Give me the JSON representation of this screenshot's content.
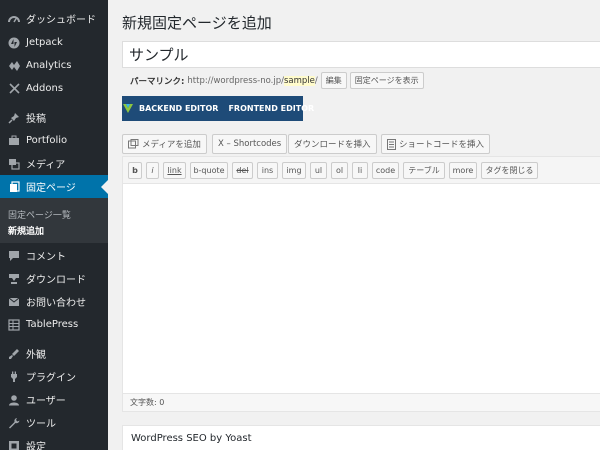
{
  "sidebar": {
    "items": [
      {
        "label": "ダッシュボード",
        "icon": "dashboard-icon"
      },
      {
        "label": "Jetpack",
        "icon": "jetpack-icon"
      },
      {
        "label": "Analytics",
        "icon": "analytics-icon"
      },
      {
        "label": "Addons",
        "icon": "addons-icon"
      },
      {
        "label": "投稿",
        "icon": "pin-icon"
      },
      {
        "label": "Portfolio",
        "icon": "portfolio-icon"
      },
      {
        "label": "メディア",
        "icon": "media-icon"
      },
      {
        "label": "固定ページ",
        "icon": "pages-icon"
      },
      {
        "label": "コメント",
        "icon": "comment-icon"
      },
      {
        "label": "ダウンロード",
        "icon": "download-icon"
      },
      {
        "label": "お問い合わせ",
        "icon": "mail-icon"
      },
      {
        "label": "TablePress",
        "icon": "table-icon"
      },
      {
        "label": "外観",
        "icon": "appearance-icon"
      },
      {
        "label": "プラグイン",
        "icon": "plugin-icon"
      },
      {
        "label": "ユーザー",
        "icon": "user-icon"
      },
      {
        "label": "ツール",
        "icon": "tools-icon"
      },
      {
        "label": "設定",
        "icon": "settings-icon"
      }
    ],
    "submenu": [
      "固定ページ一覧",
      "新規追加"
    ]
  },
  "main": {
    "title": "新規固定ページを追加",
    "post_title": "サンプル",
    "permalink": {
      "label": "パーマリンク:",
      "url_prefix": "http://wordpress-no.jp/",
      "slug": "sample",
      "url_suffix": "/",
      "edit_btn": "編集",
      "view_btn": "固定ページを表示"
    },
    "builder": {
      "backend": "BACKEND EDITOR",
      "frontend": "FRONTEND EDITOR"
    },
    "media_buttons": {
      "add_media": "メディアを追加",
      "shortcodes": "X – Shortcodes",
      "insert_download": "ダウンロードを挿入",
      "insert_shortcode": "ショートコードを挿入"
    },
    "quicktags": [
      "b",
      "i",
      "link",
      "b-quote",
      "del",
      "ins",
      "img",
      "ul",
      "ol",
      "li",
      "code",
      "テーブル",
      "more",
      "タグを閉じる"
    ],
    "word_count": "文字数: 0",
    "seo_box_title": "WordPress SEO by Yoast"
  },
  "colors": {
    "sidebar_bg": "#23282d",
    "active_item": "#0073aa",
    "builder_bar": "#1e4b78"
  }
}
